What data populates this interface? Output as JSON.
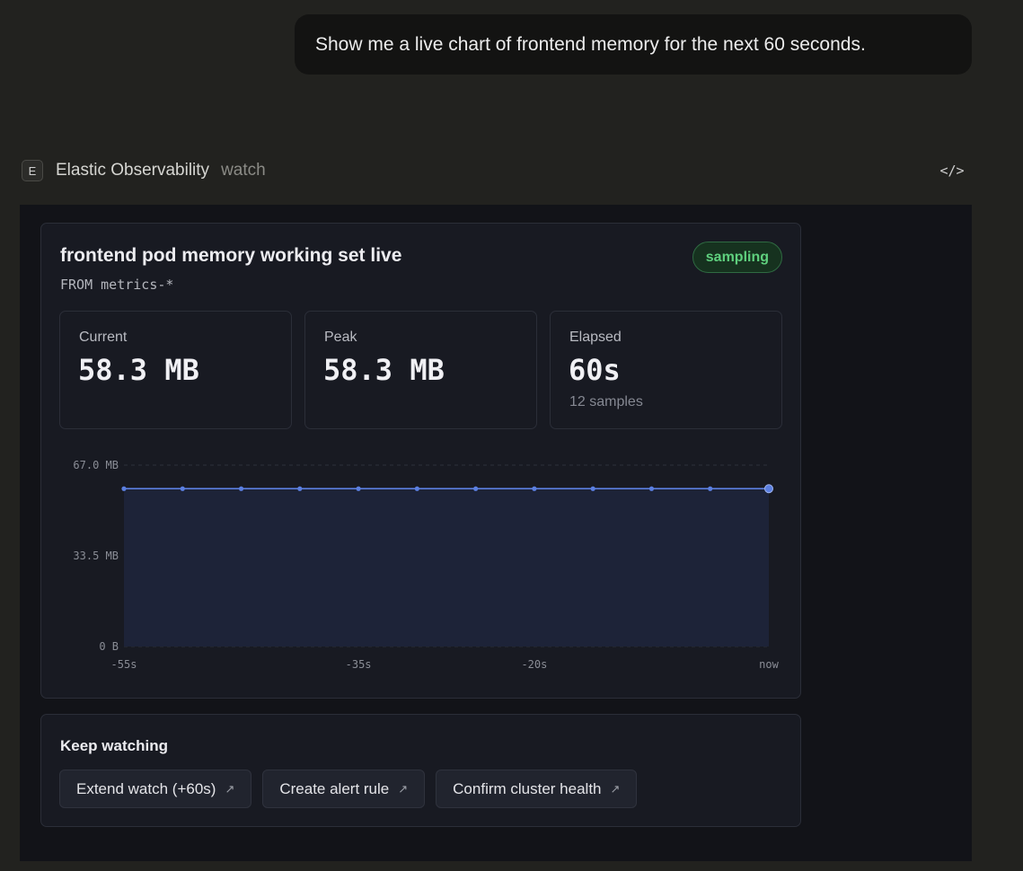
{
  "user_message": "Show me a live chart of frontend memory for the next 60 seconds.",
  "tool": {
    "badge": "E",
    "name": "Elastic Observability",
    "action": "watch",
    "code_icon": "</>"
  },
  "card": {
    "title": "frontend pod memory working set live",
    "query": "FROM metrics-*",
    "status": "sampling",
    "status_color": "#5fd07e"
  },
  "stats": [
    {
      "label": "Current",
      "value": "58.3 MB",
      "sub": ""
    },
    {
      "label": "Peak",
      "value": "58.3 MB",
      "sub": ""
    },
    {
      "label": "Elapsed",
      "value": "60s",
      "sub": "12 samples"
    }
  ],
  "chart_data": {
    "type": "area",
    "x": [
      -55,
      -50,
      -45,
      -40,
      -35,
      -30,
      -25,
      -20,
      -15,
      -10,
      -5,
      0
    ],
    "values": [
      58.3,
      58.3,
      58.3,
      58.3,
      58.3,
      58.3,
      58.3,
      58.3,
      58.3,
      58.3,
      58.3,
      58.3
    ],
    "unit": "MB",
    "ylim": [
      0,
      67.0
    ],
    "y_ticks": [
      {
        "v": 67.0,
        "label": "67.0 MB"
      },
      {
        "v": 33.5,
        "label": "33.5 MB"
      },
      {
        "v": 0,
        "label": "0 B"
      }
    ],
    "x_ticks": [
      {
        "v": -55,
        "label": "-55s"
      },
      {
        "v": -35,
        "label": "-35s"
      },
      {
        "v": -20,
        "label": "-20s"
      },
      {
        "v": 0,
        "label": "now"
      }
    ],
    "line_color": "#5b7fe0",
    "fill_color": "#1d2338",
    "grid": true
  },
  "actions": {
    "title": "Keep watching",
    "buttons": [
      {
        "label": "Extend watch (+60s)",
        "icon": "arrow-up-right-icon"
      },
      {
        "label": "Create alert rule",
        "icon": "arrow-up-right-icon"
      },
      {
        "label": "Confirm cluster health",
        "icon": "arrow-up-right-icon"
      }
    ]
  }
}
